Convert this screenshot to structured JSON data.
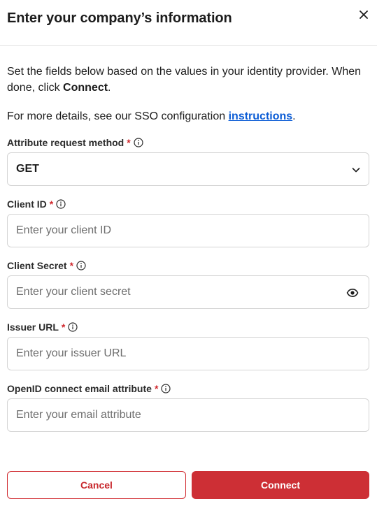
{
  "dialog": {
    "title": "Enter your company’s information",
    "intro_text": "Set the fields below based on the values in your identity provider. When done, click ",
    "intro_bold": "Connect",
    "intro_end": ".",
    "details_text": "For more details, see our SSO configuration ",
    "details_link": "instructions",
    "details_end": "."
  },
  "fields": {
    "method": {
      "label": "Attribute request method",
      "required_mark": "*",
      "value": "GET"
    },
    "client_id": {
      "label": "Client ID",
      "required_mark": "*",
      "placeholder": "Enter your client ID",
      "value": ""
    },
    "client_secret": {
      "label": "Client Secret",
      "required_mark": "*",
      "placeholder": "Enter your client secret",
      "value": ""
    },
    "issuer_url": {
      "label": "Issuer URL",
      "required_mark": "*",
      "placeholder": "Enter your issuer URL",
      "value": ""
    },
    "email_attr": {
      "label": "OpenID connect email attribute",
      "required_mark": "*",
      "placeholder": "Enter your email attribute",
      "value": ""
    }
  },
  "buttons": {
    "cancel": "Cancel",
    "connect": "Connect"
  },
  "colors": {
    "accent": "#cd2f35",
    "link": "#0b5cd5",
    "required": "#d0282d"
  },
  "icons": {
    "close": "close-icon",
    "info": "info-icon",
    "chevron": "chevron-down-icon",
    "eye": "eye-icon"
  }
}
